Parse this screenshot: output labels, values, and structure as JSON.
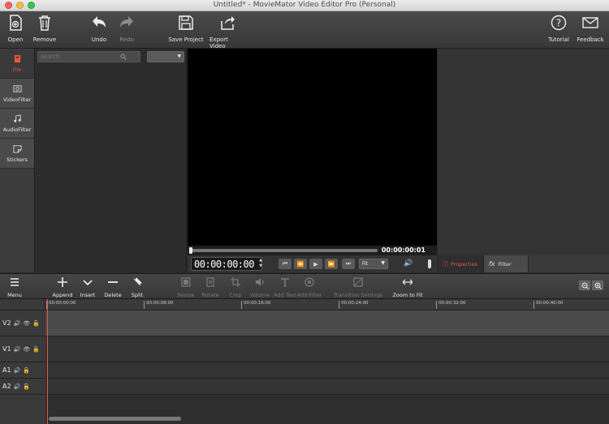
{
  "window": {
    "title": "Untitled* - MovieMator Video Editor Pro (Personal)"
  },
  "colors": {
    "accent": "#e8563c",
    "close": "#fc605c",
    "minimize": "#fdbc40",
    "zoom": "#34c84a"
  },
  "toolbar": {
    "open": "Open",
    "remove": "Remove",
    "undo": "Undo",
    "redo": "Redo",
    "save_project": "Save Project",
    "export_video": "Export Video",
    "tutorial": "Tutorial",
    "feedback": "Feedback"
  },
  "nav": {
    "file": "File",
    "video_filter": "VideoFilter",
    "audio_filter": "AudioFilter",
    "stickers": "Stickers"
  },
  "file_panel": {
    "search_placeholder": "search"
  },
  "player": {
    "timecode": "00:00:00:00",
    "duration": "00:00:00:01",
    "zoom_value": "Fit",
    "progress": 0
  },
  "properties": {
    "tab_properties": "Properties",
    "tab_filter": "Filter",
    "fx_icon": "fx"
  },
  "timeline_toolbar": {
    "menu": "Menu",
    "append": "Append",
    "insert": "Insert",
    "delete": "Delete",
    "split": "Split",
    "resize": "Resize",
    "rotate": "Rotate",
    "crop": "Crop",
    "volume": "Volume",
    "add_text": "Add Text",
    "add_filter": "Add Filter",
    "transition_settings": "Transition Settings",
    "zoom_to_fit": "Zoom to Fit"
  },
  "ruler_ticks": [
    "00:00:00:00",
    "00:00:08:00",
    "00:00:16:00",
    "00:00:24:00",
    "00:00:32:00",
    "00:00:40:00"
  ],
  "tracks": [
    "V2",
    "V1",
    "A1",
    "A2"
  ]
}
